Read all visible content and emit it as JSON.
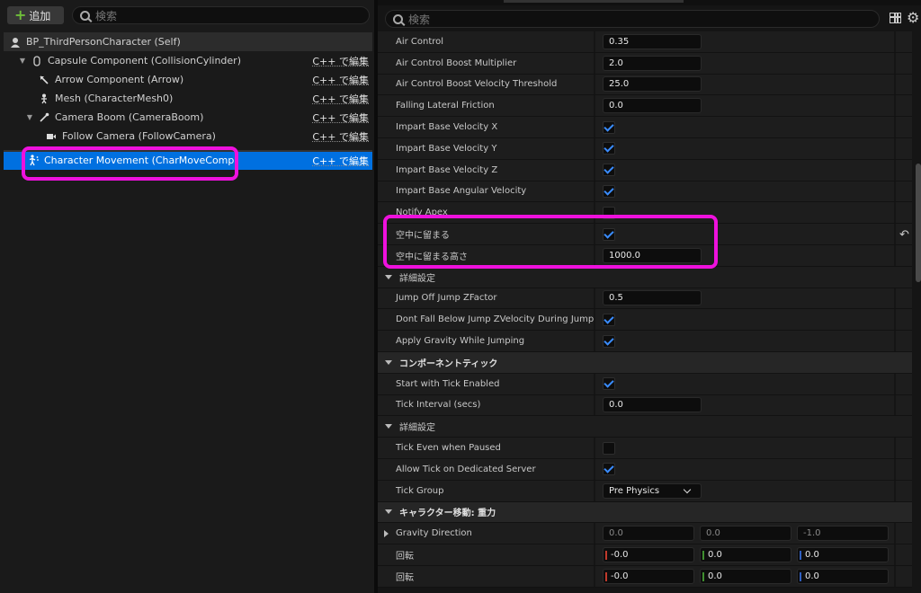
{
  "left": {
    "add_label": "追加",
    "search_placeholder": "検索",
    "edit_label": "C++ で編集",
    "tree": [
      {
        "label": "BP_ThirdPersonCharacter (Self)",
        "icon": "person-icon"
      },
      {
        "label": "Capsule Component (CollisionCylinder)",
        "icon": "capsule-icon"
      },
      {
        "label": "Arrow Component (Arrow)",
        "icon": "arrow-icon"
      },
      {
        "label": "Mesh (CharacterMesh0)",
        "icon": "skeleton-icon"
      },
      {
        "label": "Camera Boom (CameraBoom)",
        "icon": "spring-arm-icon"
      },
      {
        "label": "Follow Camera (FollowCamera)",
        "icon": "camera-icon"
      },
      {
        "label": "Character Movement (CharMoveComp)",
        "icon": "movement-icon"
      }
    ]
  },
  "right": {
    "search_placeholder": "検索",
    "props": [
      {
        "name": "Air Control",
        "type": "num",
        "value": "0.35"
      },
      {
        "name": "Air Control Boost Multiplier",
        "type": "num",
        "value": "2.0"
      },
      {
        "name": "Air Control Boost Velocity Threshold",
        "type": "num",
        "value": "25.0"
      },
      {
        "name": "Falling Lateral Friction",
        "type": "num",
        "value": "0.0"
      },
      {
        "name": "Impart Base Velocity X",
        "type": "chk",
        "checked": true
      },
      {
        "name": "Impart Base Velocity Y",
        "type": "chk",
        "checked": true
      },
      {
        "name": "Impart Base Velocity Z",
        "type": "chk",
        "checked": true
      },
      {
        "name": "Impart Base Angular Velocity",
        "type": "chk",
        "checked": true
      },
      {
        "name": "Notify Apex",
        "type": "chk",
        "checked": false
      },
      {
        "name": "空中に留まる",
        "type": "chk",
        "checked": true
      },
      {
        "name": "空中に留まる高さ",
        "type": "num",
        "value": "1000.0"
      },
      {
        "name": "詳細設定",
        "type": "section-light"
      },
      {
        "name": "Jump Off Jump ZFactor",
        "type": "num",
        "value": "0.5"
      },
      {
        "name": "Dont Fall Below Jump ZVelocity During Jump",
        "type": "chk",
        "checked": true
      },
      {
        "name": "Apply Gravity While Jumping",
        "type": "chk",
        "checked": true
      },
      {
        "name": "コンポーネントティック",
        "type": "section"
      },
      {
        "name": "Start with Tick Enabled",
        "type": "chk",
        "checked": true
      },
      {
        "name": "Tick Interval (secs)",
        "type": "num",
        "value": "0.0"
      },
      {
        "name": "詳細設定",
        "type": "section-light"
      },
      {
        "name": "Tick Even when Paused",
        "type": "chk",
        "checked": false
      },
      {
        "name": "Allow Tick on Dedicated Server",
        "type": "chk",
        "checked": true
      },
      {
        "name": "Tick Group",
        "type": "dropdown",
        "value": "Pre Physics"
      },
      {
        "name": "キャラクター移動: 重力",
        "type": "section"
      },
      {
        "name": "Gravity Direction",
        "type": "vec3",
        "values": [
          "0.0",
          "0.0",
          "-1.0"
        ],
        "expandable": true
      },
      {
        "name": "回転",
        "type": "vec3c",
        "values": [
          "-0.0",
          "0.0",
          "0.0"
        ]
      },
      {
        "name": "回転",
        "type": "vec3c",
        "values": [
          "-0.0",
          "0.0",
          "0.0"
        ]
      }
    ]
  },
  "colors": {
    "selection": "#0070e0",
    "highlight": "#ee11dd",
    "check": "#3a8cff"
  }
}
